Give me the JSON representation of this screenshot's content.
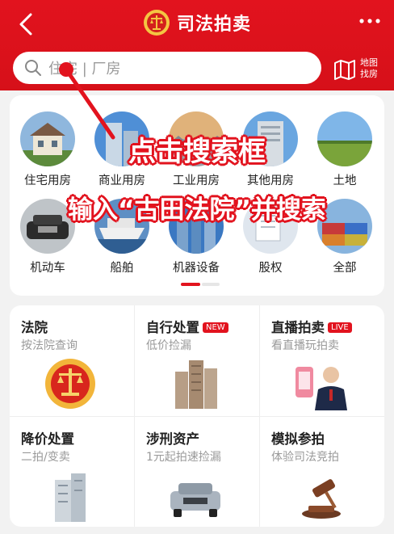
{
  "header": {
    "title": "司法拍卖",
    "back_icon": "chevron-left-icon",
    "more_icon": "more-horizontal-icon",
    "emblem_icon": "court-emblem-icon",
    "bg_color": "#e2131e"
  },
  "search": {
    "placeholder": "住宅 | 厂房",
    "map_label_line1": "地图",
    "map_label_line2": "找房"
  },
  "categories": [
    {
      "label": "住宅用房",
      "icon": "house-icon"
    },
    {
      "label": "商业用房",
      "icon": "commercial-building-icon"
    },
    {
      "label": "工业用房",
      "icon": "factory-icon"
    },
    {
      "label": "其他用房",
      "icon": "building-icon"
    },
    {
      "label": "土地",
      "icon": "land-icon"
    },
    {
      "label": "机动车",
      "icon": "car-icon"
    },
    {
      "label": "船舶",
      "icon": "ship-icon"
    },
    {
      "label": "机器设备",
      "icon": "machinery-icon"
    },
    {
      "label": "股权",
      "icon": "equity-document-icon"
    },
    {
      "label": "全部",
      "icon": "containers-icon"
    }
  ],
  "services": [
    {
      "title": "法院",
      "subtitle": "按法院查询",
      "badge": "",
      "icon": "court-emblem-icon"
    },
    {
      "title": "自行处置",
      "subtitle": "低价捡漏",
      "badge": "NEW",
      "icon": "apartment-buildings-icon"
    },
    {
      "title": "直播拍卖",
      "subtitle": "看直播玩拍卖",
      "badge": "LIVE",
      "icon": "live-host-icon"
    },
    {
      "title": "降价处置",
      "subtitle": "二拍/变卖",
      "badge": "",
      "icon": "tower-building-icon"
    },
    {
      "title": "涉刑资产",
      "subtitle": "1元起拍速捡漏",
      "badge": "",
      "icon": "suv-car-icon"
    },
    {
      "title": "模拟参拍",
      "subtitle": "体验司法竞拍",
      "badge": "",
      "icon": "gavel-icon"
    }
  ],
  "annotations": {
    "line1": "点击搜索框",
    "line2": "输入“古田法院”并搜索",
    "color": "#e2131e"
  }
}
